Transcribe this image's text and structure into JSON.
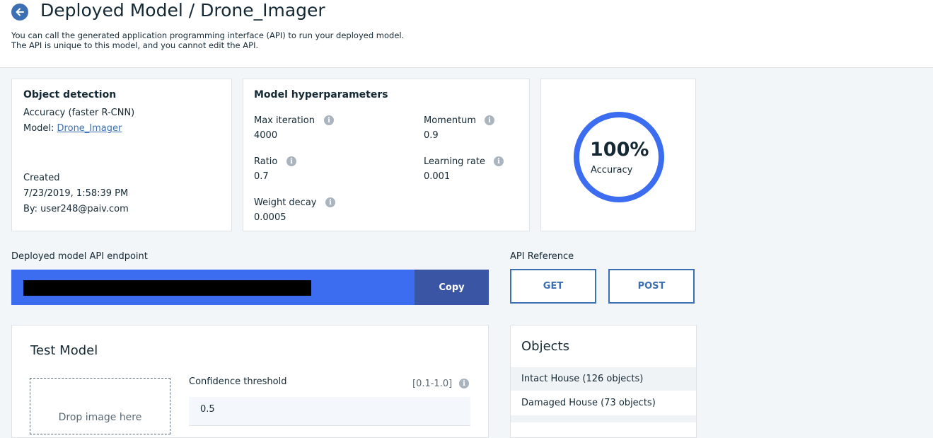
{
  "header": {
    "title": "Deployed Model / Drone_Imager",
    "description_line1": "You can call the generated application programming interface (API) to run your deployed model.",
    "description_line2": "The API is unique to this model, and you cannot edit the API."
  },
  "detection_card": {
    "title": "Object detection",
    "accuracy_type": "Accuracy (faster R-CNN)",
    "model_prefix": "Model: ",
    "model_link": "Drone_Imager",
    "created_label": "Created",
    "created_date": "7/23/2019, 1:58:39 PM",
    "created_by": "By: user248@paiv.com"
  },
  "hyperparams": {
    "title": "Model hyperparameters",
    "items": [
      {
        "label": "Max iteration",
        "value": "4000"
      },
      {
        "label": "Momentum",
        "value": "0.9"
      },
      {
        "label": "Ratio",
        "value": "0.7"
      },
      {
        "label": "Learning rate",
        "value": "0.001"
      },
      {
        "label": "Weight decay",
        "value": "0.0005"
      }
    ]
  },
  "accuracy": {
    "value_text": "100%",
    "value": 1.0,
    "label": "Accuracy",
    "ring_color": "#3c6df0"
  },
  "endpoint": {
    "label": "Deployed model API endpoint",
    "copy_label": "Copy",
    "bar_color": "#3c6df0"
  },
  "api_reference": {
    "label": "API Reference",
    "get_label": "GET",
    "post_label": "POST"
  },
  "test_model": {
    "title": "Test Model",
    "drop_text": "Drop image here",
    "confidence_label": "Confidence threshold",
    "range_text": "[0.1-1.0]",
    "confidence_value": "0.5"
  },
  "objects": {
    "title": "Objects",
    "items": [
      {
        "label": "Intact House (126 objects)"
      },
      {
        "label": "Damaged House (73 objects)"
      }
    ]
  },
  "icons": {
    "back": "arrow-left-icon",
    "info": "info-icon"
  }
}
